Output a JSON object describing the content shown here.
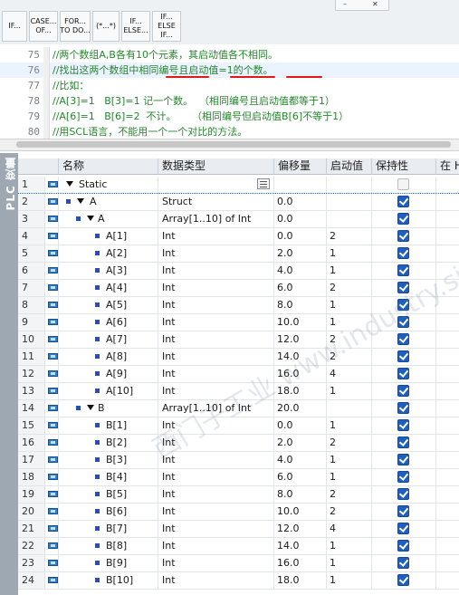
{
  "toolbar": {
    "buttons": [
      {
        "label": "IF..."
      },
      {
        "label": "CASE...\nOF..."
      },
      {
        "label": "FOR...\nTO DO..."
      },
      {
        "label": "(*...*)"
      },
      {
        "label": "IF...\nELSE..."
      },
      {
        "label": "IF...\nELSE\nIF..."
      }
    ]
  },
  "editor": {
    "lines": [
      {
        "num": "75",
        "text": "//两个数组A,B各有10个元素，其启动值各不相同。"
      },
      {
        "num": "76",
        "text": "//找出这两个数组中相同编号且启动值=1的个数。"
      },
      {
        "num": "77",
        "text": "//比如："
      },
      {
        "num": "78",
        "text": "//A[3]=1   B[3]=1 记一个数。  （相同编号且启动值都等于1）"
      },
      {
        "num": "79",
        "text": "//A[6]=1   B[6]=2  不计。     （相同编号但启动值B[6]不等于1）"
      },
      {
        "num": "80",
        "text": "//用SCL语言，不能用一个一个对比的方法。"
      }
    ]
  },
  "sidebar": {
    "label": "PLC 变量"
  },
  "table": {
    "headers": {
      "name": "名称",
      "type": "数据类型",
      "offset": "偏移量",
      "start": "启动值",
      "retain": "保持性",
      "more": "在 H"
    },
    "rows": [
      {
        "num": "1",
        "name": "Static",
        "type": "",
        "offset": "",
        "start": "",
        "retain": false
      },
      {
        "num": "2",
        "name": "A",
        "type": "Struct",
        "offset": "0.0",
        "start": "",
        "retain": true
      },
      {
        "num": "3",
        "name": "A",
        "type": "Array[1..10] of Int",
        "offset": "0.0",
        "start": "",
        "retain": true
      },
      {
        "num": "4",
        "name": "A[1]",
        "type": "Int",
        "offset": "0.0",
        "start": "2",
        "retain": true
      },
      {
        "num": "5",
        "name": "A[2]",
        "type": "Int",
        "offset": "2.0",
        "start": "1",
        "retain": true
      },
      {
        "num": "6",
        "name": "A[3]",
        "type": "Int",
        "offset": "4.0",
        "start": "1",
        "retain": true
      },
      {
        "num": "7",
        "name": "A[4]",
        "type": "Int",
        "offset": "6.0",
        "start": "2",
        "retain": true
      },
      {
        "num": "8",
        "name": "A[5]",
        "type": "Int",
        "offset": "8.0",
        "start": "1",
        "retain": true
      },
      {
        "num": "9",
        "name": "A[6]",
        "type": "Int",
        "offset": "10.0",
        "start": "1",
        "retain": true
      },
      {
        "num": "10",
        "name": "A[7]",
        "type": "Int",
        "offset": "12.0",
        "start": "2",
        "retain": true
      },
      {
        "num": "11",
        "name": "A[8]",
        "type": "Int",
        "offset": "14.0",
        "start": "2",
        "retain": true
      },
      {
        "num": "12",
        "name": "A[9]",
        "type": "Int",
        "offset": "16.0",
        "start": "4",
        "retain": true
      },
      {
        "num": "13",
        "name": "A[10]",
        "type": "Int",
        "offset": "18.0",
        "start": "1",
        "retain": true
      },
      {
        "num": "14",
        "name": "B",
        "type": "Array[1..10] of Int",
        "offset": "20.0",
        "start": "",
        "retain": true
      },
      {
        "num": "15",
        "name": "B[1]",
        "type": "Int",
        "offset": "0.0",
        "start": "1",
        "retain": true
      },
      {
        "num": "16",
        "name": "B[2]",
        "type": "Int",
        "offset": "2.0",
        "start": "2",
        "retain": true
      },
      {
        "num": "17",
        "name": "B[3]",
        "type": "Int",
        "offset": "4.0",
        "start": "1",
        "retain": true
      },
      {
        "num": "18",
        "name": "B[4]",
        "type": "Int",
        "offset": "6.0",
        "start": "1",
        "retain": true
      },
      {
        "num": "19",
        "name": "B[5]",
        "type": "Int",
        "offset": "8.0",
        "start": "2",
        "retain": true
      },
      {
        "num": "20",
        "name": "B[6]",
        "type": "Int",
        "offset": "10.0",
        "start": "2",
        "retain": true
      },
      {
        "num": "21",
        "name": "B[7]",
        "type": "Int",
        "offset": "12.0",
        "start": "4",
        "retain": true
      },
      {
        "num": "22",
        "name": "B[8]",
        "type": "Int",
        "offset": "14.0",
        "start": "1",
        "retain": true
      },
      {
        "num": "23",
        "name": "B[9]",
        "type": "Int",
        "offset": "16.0",
        "start": "1",
        "retain": true
      },
      {
        "num": "24",
        "name": "B[10]",
        "type": "Int",
        "offset": "18.0",
        "start": "1",
        "retain": true
      }
    ]
  },
  "watermark": {
    "text": "西门子工业 www.industry.siemens.com.cn"
  },
  "colors": {
    "comment": "#26862e",
    "checkbox": "#1f5fbf",
    "underline": "#e01818",
    "header_bg": "#e9edf1"
  }
}
